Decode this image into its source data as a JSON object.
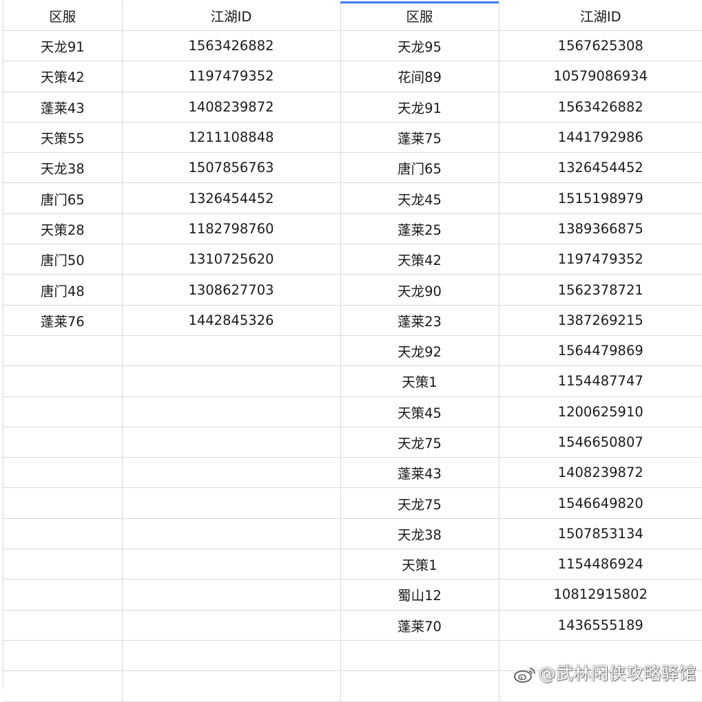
{
  "table": {
    "columns": [
      "区服",
      "江湖ID",
      "区服",
      "江湖ID"
    ],
    "rows": [
      [
        "天龙91",
        "1563426882",
        "天龙95",
        "1567625308"
      ],
      [
        "天策42",
        "1197479352",
        "花间89",
        "10579086934"
      ],
      [
        "蓬莱43",
        "1408239872",
        "天龙91",
        "1563426882"
      ],
      [
        "天策55",
        "1211108848",
        "蓬莱75",
        "1441792986"
      ],
      [
        "天龙38",
        "1507856763",
        "唐门65",
        "1326454452"
      ],
      [
        "唐门65",
        "1326454452",
        "天龙45",
        "1515198979"
      ],
      [
        "天策28",
        "1182798760",
        "蓬莱25",
        "1389366875"
      ],
      [
        "唐门50",
        "1310725620",
        "天策42",
        "1197479352"
      ],
      [
        "唐门48",
        "1308627703",
        "天龙90",
        "1562378721"
      ],
      [
        "蓬莱76",
        "1442845326",
        "蓬莱23",
        "1387269215"
      ],
      [
        "",
        "",
        "天龙92",
        "1564479869"
      ],
      [
        "",
        "",
        "天策1",
        "1154487747"
      ],
      [
        "",
        "",
        "天策45",
        "1200625910"
      ],
      [
        "",
        "",
        "天龙75",
        "1546650807"
      ],
      [
        "",
        "",
        "蓬莱43",
        "1408239872"
      ],
      [
        "",
        "",
        "天龙75",
        "1546649820"
      ],
      [
        "",
        "",
        "天龙38",
        "1507853134"
      ],
      [
        "",
        "",
        "天策1",
        "1154486924"
      ],
      [
        "",
        "",
        "蜀山12",
        "10812915802"
      ],
      [
        "",
        "",
        "蓬莱70",
        "1436555189"
      ],
      [
        "",
        "",
        "",
        ""
      ],
      [
        "",
        "",
        "",
        ""
      ]
    ]
  },
  "watermark": {
    "text": "@武林闲侠攻略驿馆",
    "icon": "weibo-icon"
  },
  "colors": {
    "grid_line": "#d9d9d9",
    "selection_accent": "#3b7be9",
    "text": "#1a1a1a"
  }
}
